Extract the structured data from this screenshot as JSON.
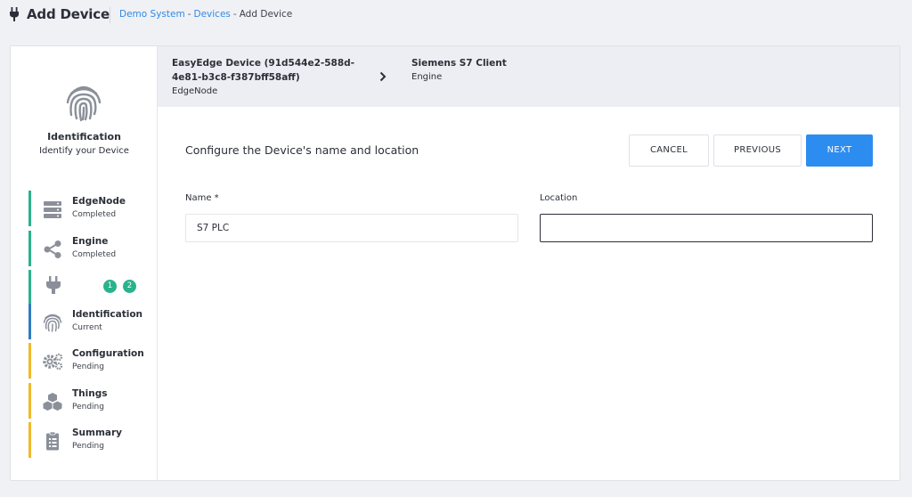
{
  "header": {
    "title": "Add Device",
    "breadcrumb": {
      "items": [
        "Demo System",
        "Devices",
        "Add Device"
      ],
      "separator": "-"
    }
  },
  "colors": {
    "accent": "#2d8cf0",
    "completed": "#2ab38a",
    "current": "#2f7dc1",
    "pending": "#f0b928",
    "icon_gray": "#8a8f99"
  },
  "sidebar": {
    "hero": {
      "icon": "fingerprint-icon",
      "title": "Identification",
      "subtitle": "Identify your Device"
    },
    "steps": [
      {
        "name": "EdgeNode",
        "status": "Completed",
        "icon": "server-icon",
        "state": "completed"
      },
      {
        "name": "Engine",
        "status": "Completed",
        "icon": "share-icon",
        "state": "completed"
      },
      {
        "name": "",
        "status": "",
        "icon": "plug-icon",
        "state": "completed",
        "badges": [
          "1",
          "2"
        ]
      },
      {
        "name": "Identification",
        "status": "Current",
        "icon": "fingerprint-icon",
        "state": "current"
      },
      {
        "name": "Configuration",
        "status": "Pending",
        "icon": "gears-icon",
        "state": "pending"
      },
      {
        "name": "Things",
        "status": "Pending",
        "icon": "cubes-icon",
        "state": "pending"
      },
      {
        "name": "Summary",
        "status": "Pending",
        "icon": "clipboard-icon",
        "state": "pending"
      }
    ]
  },
  "path": {
    "items": [
      {
        "name": "EasyEdge Device (91d544e2-588d-4e81-b3c8-f387bff58aff)",
        "type": "EdgeNode"
      },
      {
        "name": "Siemens S7 Client",
        "type": "Engine"
      }
    ]
  },
  "main": {
    "section_title": "Configure the Device's name and location",
    "buttons": {
      "cancel": "CANCEL",
      "previous": "PREVIOUS",
      "next": "NEXT"
    },
    "fields": {
      "name": {
        "label": "Name *",
        "value": "S7 PLC"
      },
      "location": {
        "label": "Location",
        "value": ""
      }
    }
  }
}
